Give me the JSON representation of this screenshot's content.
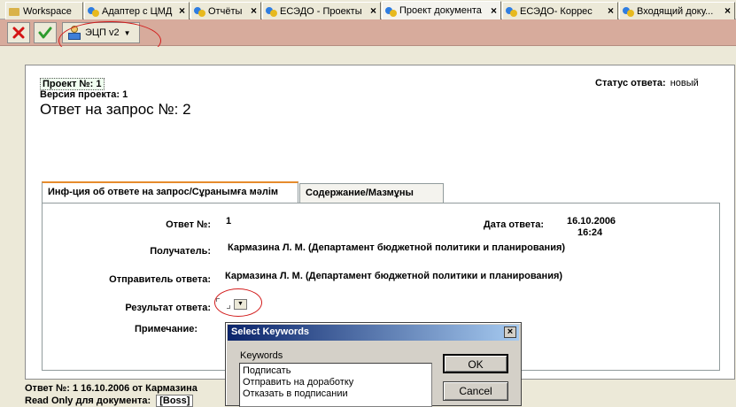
{
  "tabs": [
    {
      "label": "Workspace",
      "icon": "folder-icon"
    },
    {
      "label": "Адаптер с ЦМД",
      "icon": "document-icon"
    },
    {
      "label": "Отчёты",
      "icon": "document-icon"
    },
    {
      "label": "ЕСЭДО - Проекты",
      "icon": "document-icon"
    },
    {
      "label": "Проект документа",
      "icon": "document-icon"
    },
    {
      "label": "ЕСЭДО- Коррес",
      "icon": "document-icon"
    },
    {
      "label": "Входящий доку...",
      "icon": "document-icon"
    }
  ],
  "toolbar": {
    "cancel_icon": "close-x-icon",
    "ok_icon": "checkmark-icon",
    "ecp_label": "ЭЦП v2"
  },
  "document": {
    "project_no": "Проект №: 1",
    "project_version": "Версия проекта: 1",
    "status_label": "Статус ответа:",
    "status_value": "новый",
    "title": "Ответ на запрос №:  2",
    "tabs": {
      "info": "Инф-ция об ответе на запрос/Сұранымға мәлім",
      "content": "Содержание/Мазмұны"
    },
    "fields": {
      "answer_no_label": "Ответ №:",
      "answer_no_value": "1",
      "answer_date_label": "Дата ответа:",
      "answer_date_value": "16.10.2006",
      "answer_time_value": "16:24",
      "recipient_label": "Получатель:",
      "recipient_value": "Кармазина Л. М. (Департамент бюджетной политики и планирования)",
      "sender_label": "Отправитель ответа:",
      "sender_value": "Кармазина Л. М. (Департамент бюджетной политики и планирования)",
      "result_label": "Результат ответа:",
      "note_label": "Примечание:"
    }
  },
  "footer": {
    "line1": "Ответ №: 1 16.10.2006 от Кармазина",
    "line2": "Read Only для документа:",
    "boss": "[Boss]"
  },
  "dialog": {
    "title": "Select Keywords",
    "keywords_label": "Keywords",
    "items": [
      "Подписать",
      "Отправить на доработку",
      "Отказать в подписании"
    ],
    "ok_label": "OK",
    "cancel_label": "Cancel"
  },
  "colors": {
    "toolbar_bg": "#d7ab9c",
    "annotation_red": "#d21c1c",
    "dialog_title": "#0a246a"
  }
}
